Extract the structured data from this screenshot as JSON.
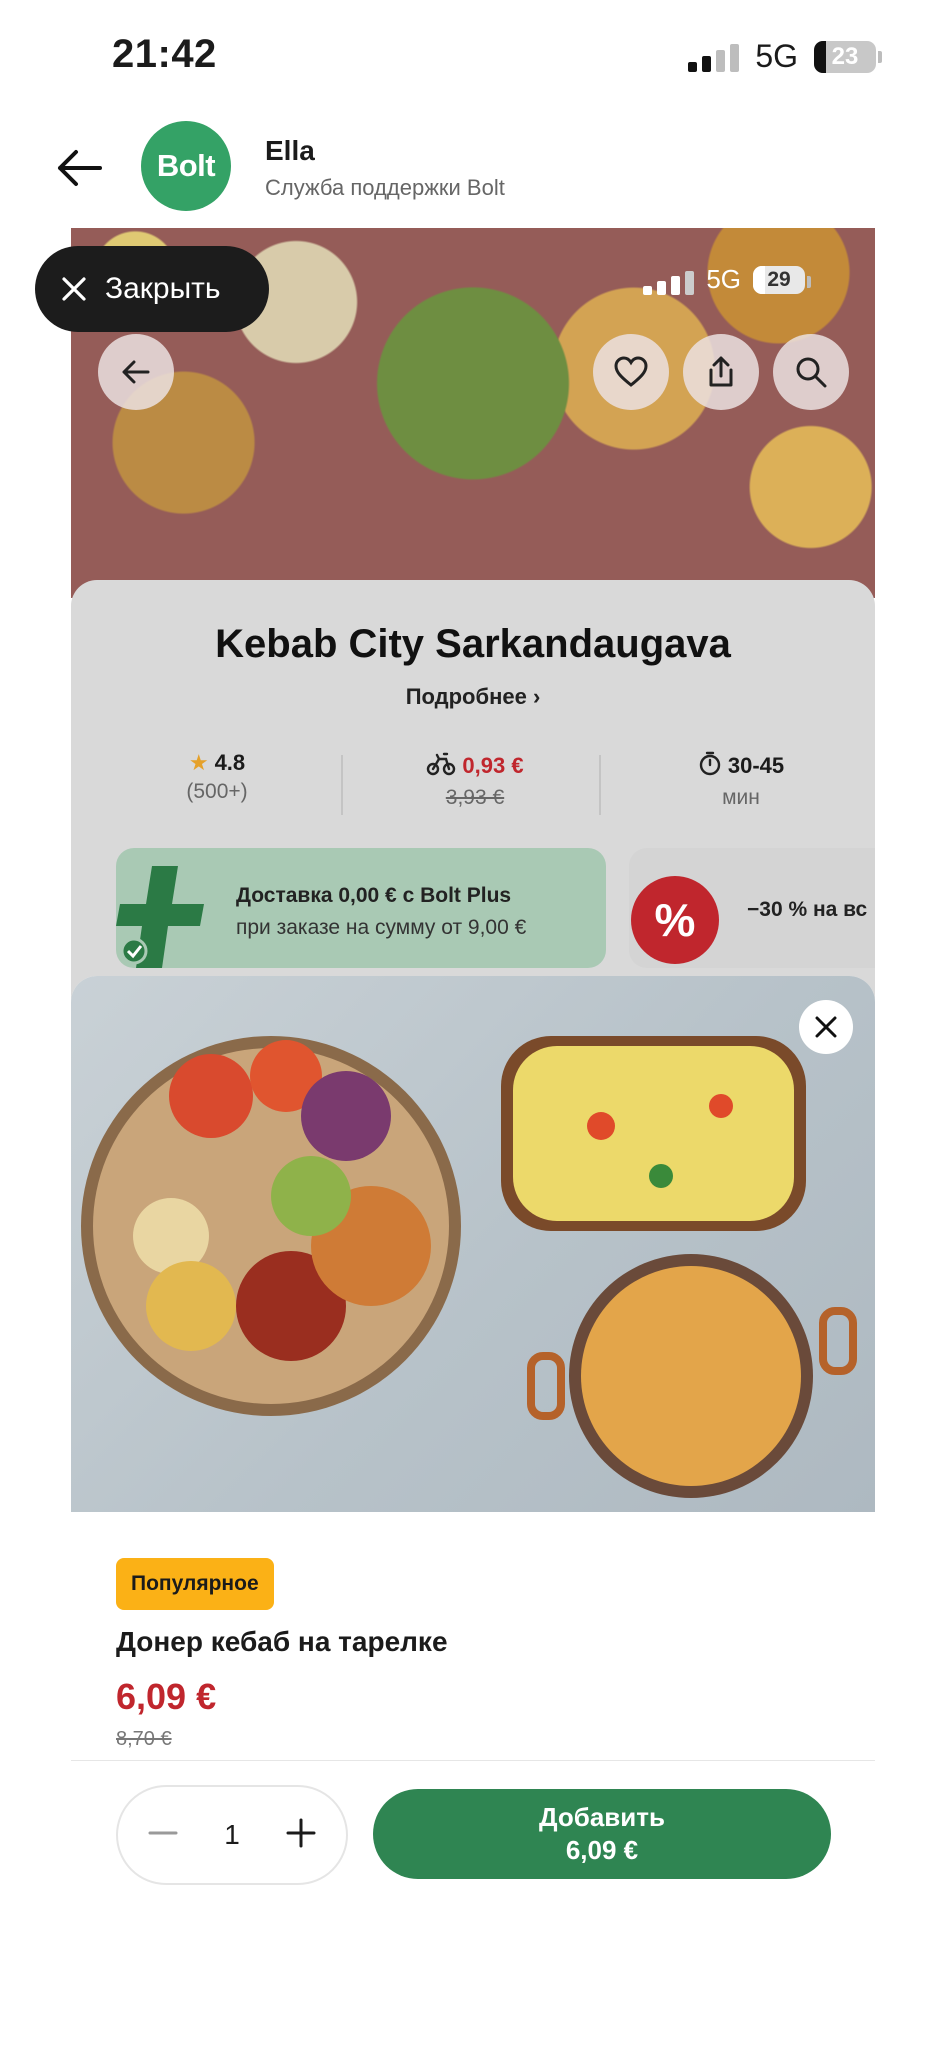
{
  "status_bar": {
    "time": "21:42",
    "network": "5G",
    "battery": "23"
  },
  "chat": {
    "name": "Ella",
    "subtitle": "Служба поддержки Bolt",
    "avatar_text": "Bolt"
  },
  "overlay": {
    "close_label": "Закрыть"
  },
  "embedded_status": {
    "network": "5G",
    "battery": "29"
  },
  "restaurant": {
    "name": "Kebab City Sarkandaugava",
    "more_label": "Подробнее",
    "rating": "4.8",
    "rating_count": "(500+)",
    "delivery_fee": "0,93 €",
    "delivery_fee_old": "3,93 €",
    "delivery_time": "30-45",
    "delivery_time_unit": "мин"
  },
  "promos": [
    {
      "title": "Доставка 0,00 € с Bolt Plus",
      "subtitle": "при заказе на сумму от 9,00 €"
    },
    {
      "title": "−30 % на вс"
    }
  ],
  "item": {
    "badge": "Популярное",
    "name": "Донер кебаб на тарелке",
    "price": "6,09 €",
    "old_price": "8,70 €",
    "quantity": "1"
  },
  "add_button": {
    "label": "Добавить",
    "price": "6,09 €"
  },
  "colors": {
    "bolt_green": "#2f8552",
    "price_red": "#c0262d",
    "badge_yellow": "#fbb116"
  }
}
